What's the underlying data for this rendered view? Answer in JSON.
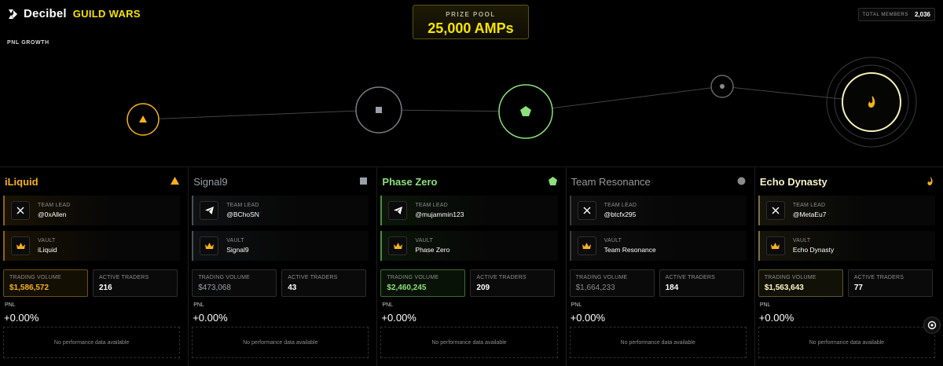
{
  "header": {
    "brand": "Decibel",
    "sub": "GUILD WARS",
    "prize_label": "PRIZE POOL",
    "prize_value": "25,000 AMPs",
    "members_label": "TOTAL MEMBERS",
    "members_value": "2,036"
  },
  "graph": {
    "title": "PNL GROWTH"
  },
  "teams": [
    {
      "name": "iLiquid",
      "icon": "triangle-icon",
      "color": "#f6b21a",
      "lead_label": "TEAM LEAD",
      "lead_social": "x-icon",
      "lead": "@0xAllen",
      "vault_label": "VAULT",
      "vault": "iLiquid",
      "vol_label": "TRADING VOLUME",
      "vol": "$1,586,572",
      "traders_label": "ACTIVE TRADERS",
      "traders": "216",
      "pnl_label": "PNL",
      "pnl": "+0.00%",
      "empty": "No performance data available"
    },
    {
      "name": "Signal9",
      "icon": "square-icon",
      "color": "#9aa0aa",
      "lead_label": "TEAM LEAD",
      "lead_social": "telegram-icon",
      "lead": "@BChoSN",
      "vault_label": "VAULT",
      "vault": "Signal9",
      "vol_label": "TRADING VOLUME",
      "vol": "$473,068",
      "traders_label": "ACTIVE TRADERS",
      "traders": "43",
      "pnl_label": "PNL",
      "pnl": "+0.00%",
      "empty": "No performance data available"
    },
    {
      "name": "Phase Zero",
      "icon": "pentagon-icon",
      "color": "#8de07b",
      "lead_label": "TEAM LEAD",
      "lead_social": "telegram-icon",
      "lead": "@mujammin123",
      "vault_label": "VAULT",
      "vault": "Phase Zero",
      "vol_label": "TRADING VOLUME",
      "vol": "$2,460,245",
      "traders_label": "ACTIVE TRADERS",
      "traders": "209",
      "pnl_label": "PNL",
      "pnl": "+0.00%",
      "empty": "No performance data available"
    },
    {
      "name": "Team Resonance",
      "icon": "circle-icon",
      "color": "#8a8a8a",
      "lead_label": "TEAM LEAD",
      "lead_social": "x-icon",
      "lead": "@btcfx295",
      "vault_label": "VAULT",
      "vault": "Team Resonance",
      "vol_label": "TRADING VOLUME",
      "vol": "$1,664,233",
      "traders_label": "ACTIVE TRADERS",
      "traders": "184",
      "pnl_label": "PNL",
      "pnl": "+0.00%",
      "empty": "No performance data available"
    },
    {
      "name": "Echo Dynasty",
      "icon": "flame-icon",
      "color": "#fff6c8",
      "lead_label": "TEAM LEAD",
      "lead_social": "x-icon",
      "lead": "@MetaEu7",
      "vault_label": "VAULT",
      "vault": "Echo Dynasty",
      "vol_label": "TRADING VOLUME",
      "vol": "$1,563,643",
      "traders_label": "ACTIVE TRADERS",
      "traders": "77",
      "pnl_label": "PNL",
      "pnl": "+0.00%",
      "empty": "No performance data available"
    }
  ]
}
